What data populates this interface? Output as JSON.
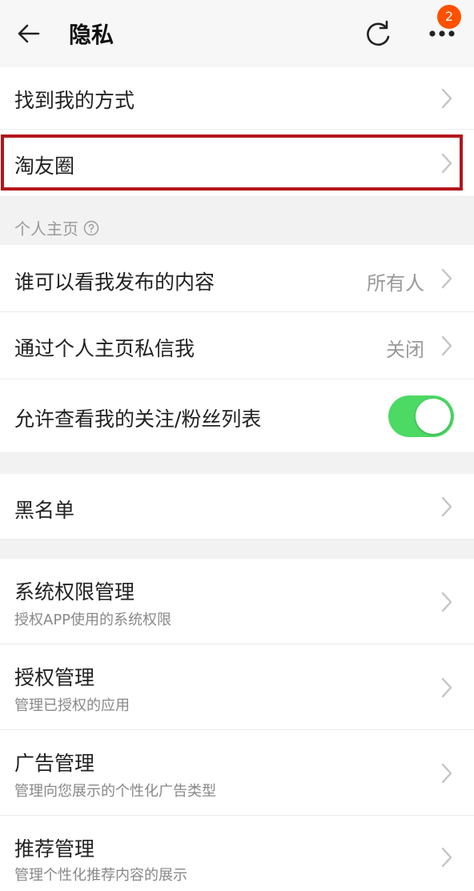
{
  "header": {
    "title": "隐私",
    "badge_count": "2",
    "icons": {
      "back": "arrow-left-icon",
      "refresh": "refresh-icon",
      "more": "more-dots-icon"
    }
  },
  "rows": {
    "find_me": {
      "label": "找到我的方式"
    },
    "taoyouquan": {
      "label": "淘友圈"
    }
  },
  "section": {
    "personal_home": "个人主页"
  },
  "personal": {
    "who_can_see": {
      "label": "谁可以看我发布的内容",
      "value": "所有人"
    },
    "dm_via_home": {
      "label": "通过个人主页私信我",
      "value": "关闭"
    },
    "allow_view_follow": {
      "label": "允许查看我的关注/粉丝列表",
      "toggle_on": true
    }
  },
  "blacklist": {
    "label": "黑名单"
  },
  "management": [
    {
      "title": "系统权限管理",
      "subtitle": "授权APP使用的系统权限"
    },
    {
      "title": "授权管理",
      "subtitle": "管理已授权的应用"
    },
    {
      "title": "广告管理",
      "subtitle": "管理向您展示的个性化广告类型"
    },
    {
      "title": "推荐管理",
      "subtitle": "管理个性化推荐内容的展示"
    }
  ],
  "colors": {
    "accent": "#ff5000",
    "toggle_on": "#4cd964",
    "highlight": "#b3161c"
  }
}
